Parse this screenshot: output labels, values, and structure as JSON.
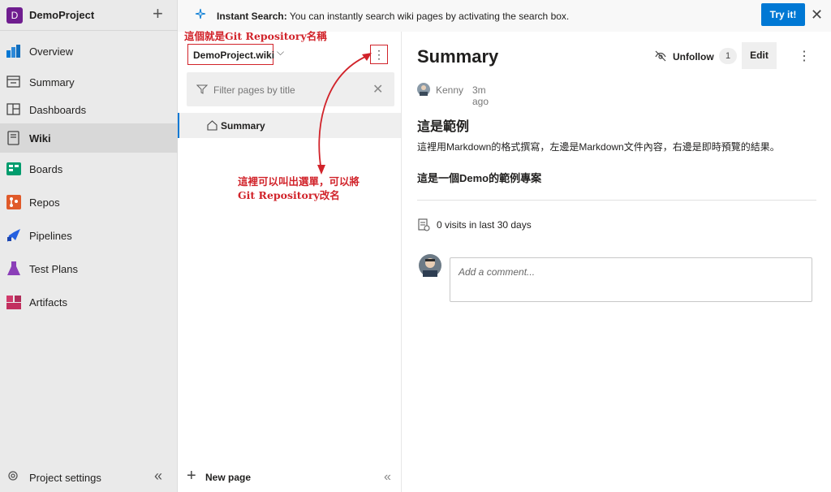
{
  "project": {
    "badge": "D",
    "name": "DemoProject"
  },
  "nav": {
    "items": [
      {
        "label": "Overview",
        "icon": "overview-icon"
      },
      {
        "label": "Summary",
        "icon": "summary-icon"
      },
      {
        "label": "Dashboards",
        "icon": "dashboards-icon"
      },
      {
        "label": "Wiki",
        "icon": "wiki-icon",
        "active": true
      },
      {
        "label": "Boards",
        "icon": "boards-icon"
      },
      {
        "label": "Repos",
        "icon": "repos-icon"
      },
      {
        "label": "Pipelines",
        "icon": "pipelines-icon"
      },
      {
        "label": "Test Plans",
        "icon": "test-plans-icon"
      },
      {
        "label": "Artifacts",
        "icon": "artifacts-icon"
      }
    ],
    "footer": {
      "label": "Project settings"
    }
  },
  "banner": {
    "title": "Instant Search:",
    "text": "You can instantly search wiki pages by activating the search box.",
    "button": "Try it!"
  },
  "tree": {
    "wiki_name": "DemoProject.wiki",
    "filter_placeholder": "Filter pages by title",
    "pages": [
      {
        "label": "Summary"
      }
    ],
    "new_page": "New page"
  },
  "annotations": {
    "repo_name": "這個就是Git Repository名稱",
    "menu_line1": "這裡可以叫出選單，可以將",
    "menu_line2": "Git Repository改名"
  },
  "page": {
    "title": "Summary",
    "unfollow": "Unfollow",
    "follow_count": "1",
    "edit": "Edit",
    "author": "Kenny",
    "time": "3m ago",
    "heading": "這是範例",
    "paragraph": "這裡用Markdown的格式撰寫，左邊是Markdown文件內容，右邊是即時預覽的結果。",
    "bold_line": "這是一個Demo的範例專案",
    "visits": "0 visits in last 30 days",
    "comment_placeholder": "Add a comment..."
  },
  "colors": {
    "accent": "#0078d4",
    "annotation": "#d1232a",
    "project_badge": "#6f1d8f"
  }
}
